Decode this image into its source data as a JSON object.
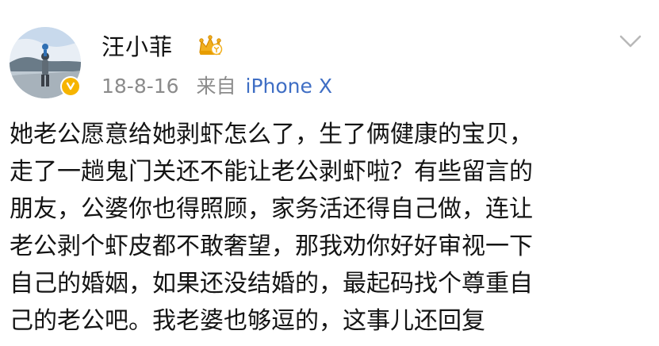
{
  "post": {
    "author": {
      "name": "汪小菲",
      "avatar_icon": "avatar-photo",
      "verified_icon": "verified-badge-icon",
      "level_badge_icon": "crown-badge-icon"
    },
    "meta": {
      "date": "18-8-16",
      "source_label": "来自",
      "device": "iPhone X"
    },
    "menu_icon": "chevron-down-icon",
    "content_lines": [
      "她老公愿意给她剥虾怎么了，生了俩健康的宝贝，",
      "走了一趟鬼门关还不能让老公剥虾啦？有些留言的",
      "朋友，公婆你也得照顾，家务活还得自己做，连让",
      "老公剥个虾皮都不敢奢望，那我劝你好好审视一下",
      "自己的婚姻，如果还没结婚的，最起码找个尊重自",
      "己的老公吧。我老婆也够逗的，这事儿还回复"
    ]
  },
  "colors": {
    "text": "#141414",
    "meta": "#8b8b8b",
    "link": "#3f6ec4",
    "verified": "#f6b400",
    "crown": "#f2b01e"
  }
}
